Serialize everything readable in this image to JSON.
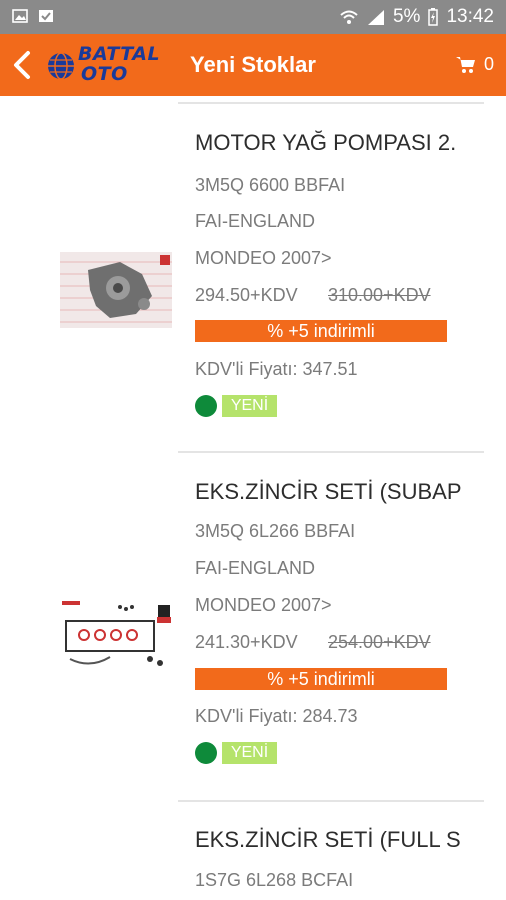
{
  "status_bar": {
    "battery_label": "5%",
    "time": "13:42",
    "icons": [
      "gallery-icon",
      "check-notification-icon",
      "wifi-icon",
      "signal-icon",
      "battery-icon"
    ]
  },
  "app_bar": {
    "logo_line1": "BATTAL",
    "logo_line2": "OTO",
    "title": "Yeni Stoklar",
    "cart_count": "0",
    "accent_color": "#f26a1b"
  },
  "products": [
    {
      "name": "MOTOR YAĞ POMPASI 2.",
      "code": "3M5Q 6600 BBFAI",
      "brand": "FAI-ENGLAND",
      "model": "MONDEO 2007>",
      "price": "294.50+KDV",
      "old_price": "310.00+KDV",
      "discount": "% +5 indirimli",
      "vat_price": "KDV'li Fiyatı: 347.51",
      "tag": "YENİ"
    },
    {
      "name": "EKS.ZİNCİR SETİ (SUBAP",
      "code": "3M5Q 6L266 BBFAI",
      "brand": "FAI-ENGLAND",
      "model": "MONDEO 2007>",
      "price": "241.30+KDV",
      "old_price": "254.00+KDV",
      "discount": "% +5 indirimli",
      "vat_price": "KDV'li Fiyatı: 284.73",
      "tag": "YENİ"
    },
    {
      "name": "EKS.ZİNCİR SETİ (FULL S",
      "code": "1S7G 6L268 BCFAI"
    }
  ]
}
